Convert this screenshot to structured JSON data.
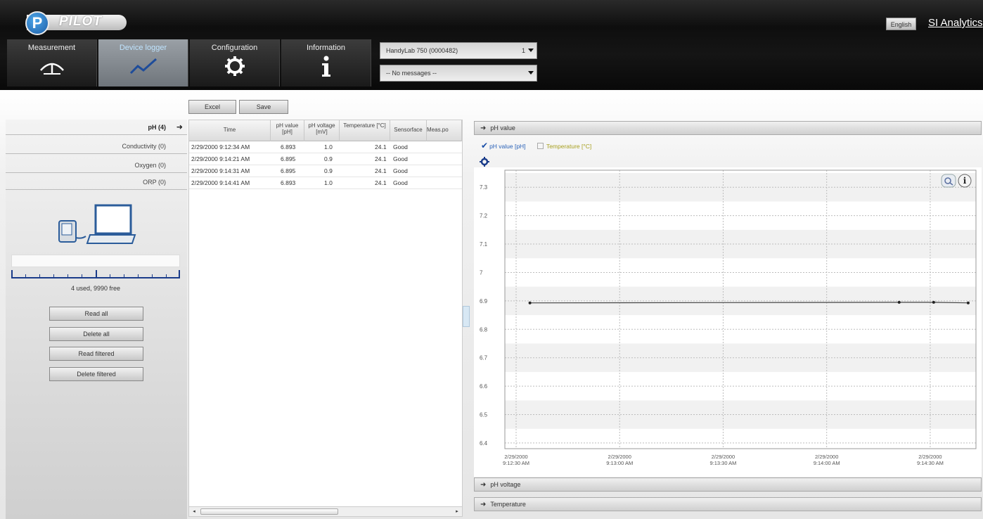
{
  "app": {
    "logo_letter": "P",
    "logo_text": "PILOT",
    "language": "English",
    "brand": "SI Analytics"
  },
  "tabs": [
    {
      "label": "Measurement",
      "icon": "gauge-icon",
      "active": false
    },
    {
      "label": "Device logger",
      "icon": "trend-chart-icon",
      "active": true
    },
    {
      "label": "Configuration",
      "icon": "gear-icon",
      "active": false
    },
    {
      "label": "Information",
      "icon": "info-icon",
      "active": false
    }
  ],
  "device_select": {
    "value": "HandyLab 750 (0000482)",
    "number": "1"
  },
  "message_select": {
    "value": "-- No messages --"
  },
  "categories": [
    {
      "label": "pH (4)",
      "active": true
    },
    {
      "label": "Conductivity (0)",
      "active": false
    },
    {
      "label": "Oxygen (0)",
      "active": false
    },
    {
      "label": "ORP (0)",
      "active": false
    }
  ],
  "memory": {
    "status": "4 used, 9990 free",
    "used_fraction": 0.0004
  },
  "left_buttons": {
    "read_all": "Read all",
    "delete_all": "Delete all",
    "read_filtered": "Read filtered",
    "delete_filtered": "Delete filtered"
  },
  "toolbar": {
    "excel": "Excel",
    "save": "Save"
  },
  "table": {
    "columns": [
      "Time",
      "pH value [pH]",
      "pH voltage [mV]",
      "Temperature [°C]",
      "Sensorface",
      "Meas.po"
    ],
    "rows": [
      [
        "2/29/2000 9:12:34 AM",
        "6.893",
        "1.0",
        "24.1",
        "Good",
        ""
      ],
      [
        "2/29/2000 9:14:21 AM",
        "6.895",
        "0.9",
        "24.1",
        "Good",
        ""
      ],
      [
        "2/29/2000 9:14:31 AM",
        "6.895",
        "0.9",
        "24.1",
        "Good",
        ""
      ],
      [
        "2/29/2000 9:14:41 AM",
        "6.893",
        "1.0",
        "24.1",
        "Good",
        ""
      ]
    ]
  },
  "chart_panels": {
    "ph_value": "pH value",
    "ph_voltage": "pH voltage",
    "temperature": "Temperature"
  },
  "legend": {
    "ph": "pH value [pH]",
    "temp": "Temperature [°C]",
    "ph_checked": true,
    "temp_checked": false
  },
  "colors": {
    "accent": "#1a4fa8",
    "active_tab": "#7f858b",
    "line": "#444444"
  },
  "chart_data": {
    "type": "line",
    "title": "",
    "xlabel": "",
    "ylabel": "",
    "y_ticks": [
      "7.3",
      "7.2",
      "7.1",
      "7",
      "6.9",
      "6.8",
      "6.7",
      "6.6",
      "6.5",
      "6.4"
    ],
    "x_ticks": [
      "2/29/2000\n9:12:30 AM",
      "2/29/2000\n9:13:00 AM",
      "2/29/2000\n9:13:30 AM",
      "2/29/2000\n9:14:00 AM",
      "2/29/2000\n9:14:30 AM"
    ],
    "x_ticks_seconds": [
      0,
      30,
      60,
      90,
      120
    ],
    "ylim": [
      6.38,
      7.36
    ],
    "series": [
      {
        "name": "pH value [pH]",
        "x": [
          4,
          111,
          121,
          131
        ],
        "values": [
          6.893,
          6.895,
          6.895,
          6.893
        ]
      }
    ],
    "grid": true
  }
}
